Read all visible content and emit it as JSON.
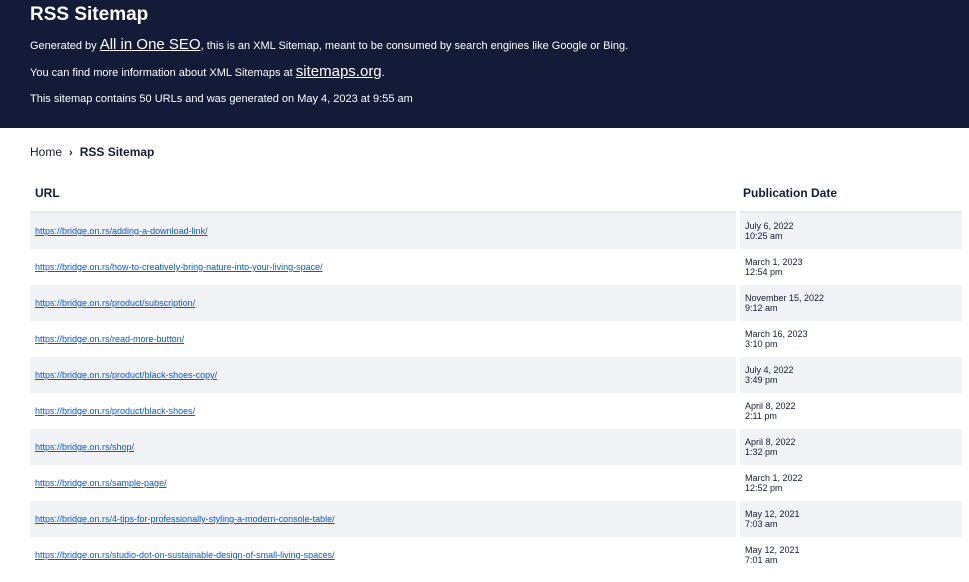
{
  "header": {
    "title": "RSS Sitemap",
    "line1_prefix": "Generated by ",
    "line1_link": "All in One SEO",
    "line1_suffix": ", this is an XML Sitemap, meant to be consumed by search engines like Google or Bing.",
    "line2_prefix": "You can find more information about XML Sitemaps at ",
    "line2_link": "sitemaps.org",
    "line2_suffix": ".",
    "line3": "This sitemap contains 50 URLs and was generated on May 4, 2023 at 9:55 am"
  },
  "breadcrumb": {
    "home": "Home",
    "separator": "›",
    "current": "RSS Sitemap"
  },
  "table": {
    "headers": {
      "url": "URL",
      "date": "Publication Date"
    },
    "rows": [
      {
        "url": "https://bridge.on.rs/adding-a-download-link/",
        "date": "July 6, 2022",
        "time": "10:25 am"
      },
      {
        "url": "https://bridge.on.rs/how-to-creatively-bring-nature-into-your-living-space/",
        "date": "March 1, 2023",
        "time": "12:54 pm"
      },
      {
        "url": "https://bridge.on.rs/product/subscription/",
        "date": "November 15, 2022",
        "time": "9:12 am"
      },
      {
        "url": "https://bridge.on.rs/read-more-button/",
        "date": "March 16, 2023",
        "time": "3:10 pm"
      },
      {
        "url": "https://bridge.on.rs/product/black-shoes-copy/",
        "date": "July 4, 2022",
        "time": "3:49 pm"
      },
      {
        "url": "https://bridge.on.rs/product/black-shoes/",
        "date": "April 8, 2022",
        "time": "2:11 pm"
      },
      {
        "url": "https://bridge.on.rs/shop/",
        "date": "April 8, 2022",
        "time": "1:32 pm"
      },
      {
        "url": "https://bridge.on.rs/sample-page/",
        "date": "March 1, 2022",
        "time": "12:52 pm"
      },
      {
        "url": "https://bridge.on.rs/4-tips-for-professionally-styling-a-modern-console-table/",
        "date": "May 12, 2021",
        "time": "7:03 am"
      },
      {
        "url": "https://bridge.on.rs/studio-dot-on-sustainable-design-of-small-living-spaces/",
        "date": "May 12, 2021",
        "time": "7:01 am"
      }
    ]
  }
}
